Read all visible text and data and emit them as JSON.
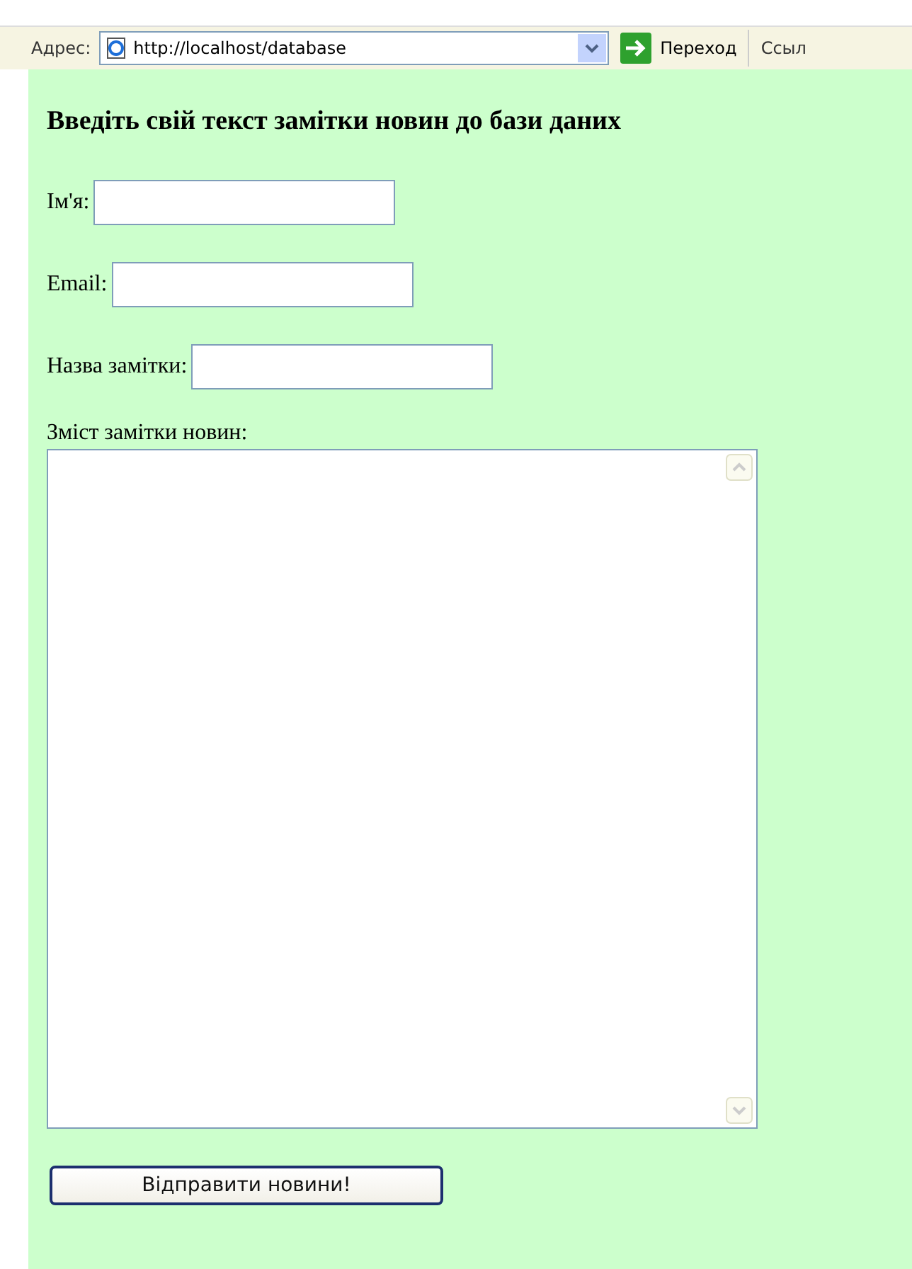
{
  "address_bar": {
    "label": "Адрес:",
    "url": "http://localhost/database",
    "go_label": "Переход",
    "links_label": "Ссыл"
  },
  "form": {
    "heading": "Введіть свій текст замітки новин до бази даних",
    "fields": [
      {
        "label": "Ім'я:"
      },
      {
        "label": "Email:"
      },
      {
        "label": "Назва замітки:"
      }
    ],
    "textarea_label": "Зміст замітки новин:",
    "submit": "Відправити новини!"
  }
}
